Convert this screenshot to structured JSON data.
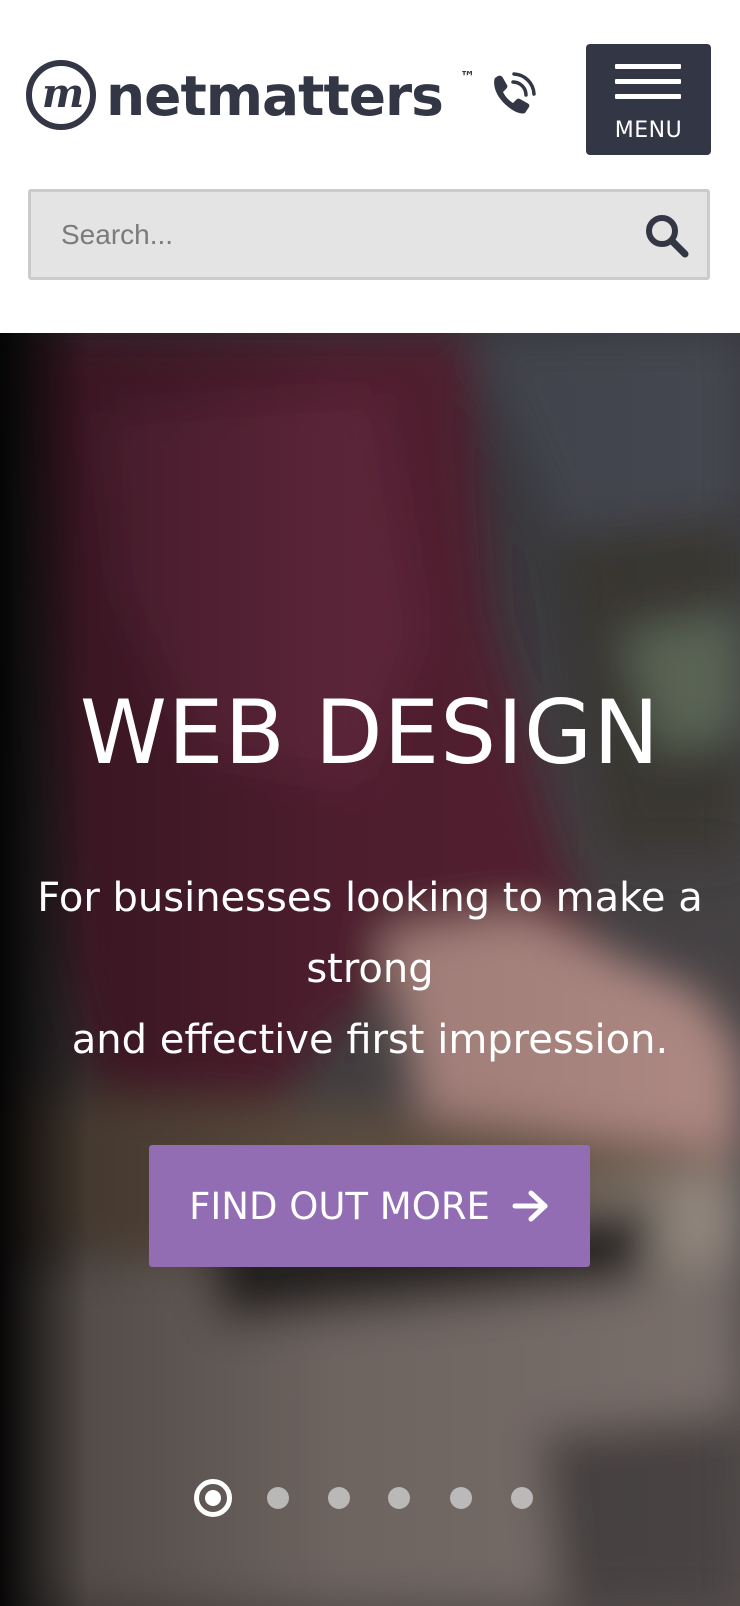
{
  "header": {
    "logo": {
      "mark": "m",
      "word": "netmatters",
      "tm": "™"
    },
    "menu_label": "MENU",
    "search": {
      "placeholder": "Search...",
      "value": ""
    },
    "colors": {
      "brand_dark": "#333645",
      "search_bg": "#e4e4e4"
    }
  },
  "hero": {
    "title": "WEB DESIGN",
    "subtitle_line1": "For businesses looking to make a strong",
    "subtitle_line2": "and effective first impression.",
    "cta_label": "FIND OUT MORE",
    "cta_color": "#926db3",
    "slide_dots": {
      "count": 6,
      "active_index": 0
    }
  }
}
